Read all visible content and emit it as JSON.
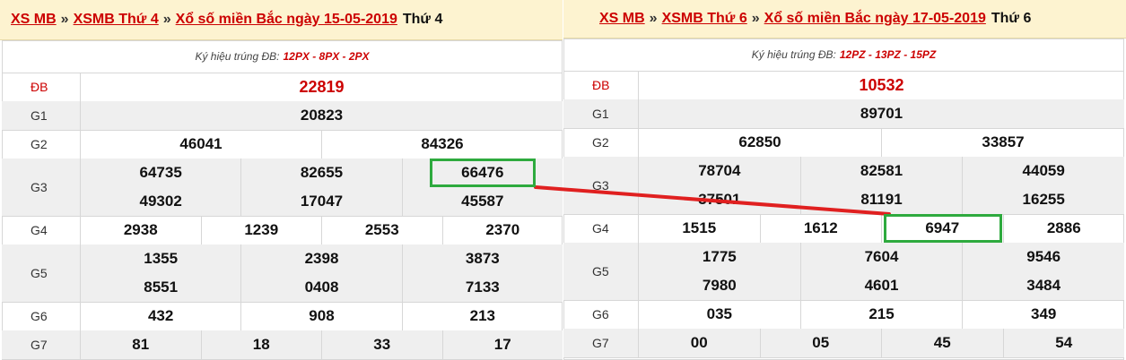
{
  "left": {
    "header": {
      "crumb1": "XS MB",
      "crumb2": "XSMB Thứ 4",
      "crumb3": "Xổ số miền Bắc ngày 15-05-2019",
      "sep": "»",
      "day": "Thứ 4"
    },
    "symbol_label": "Ký hiệu trúng ĐB:",
    "symbol_codes": "12PX - 8PX - 2PX",
    "prizes": [
      {
        "label": "ĐB",
        "rows": [
          [
            "22819"
          ]
        ]
      },
      {
        "label": "G1",
        "rows": [
          [
            "20823"
          ]
        ]
      },
      {
        "label": "G2",
        "rows": [
          [
            "46041",
            "84326"
          ]
        ]
      },
      {
        "label": "G3",
        "rows": [
          [
            "64735",
            "82655",
            "66476"
          ],
          [
            "49302",
            "17047",
            "45587"
          ]
        ]
      },
      {
        "label": "G4",
        "rows": [
          [
            "2938",
            "1239",
            "2553",
            "2370"
          ]
        ]
      },
      {
        "label": "G5",
        "rows": [
          [
            "1355",
            "2398",
            "3873"
          ],
          [
            "8551",
            "0408",
            "7133"
          ]
        ]
      },
      {
        "label": "G6",
        "rows": [
          [
            "432",
            "908",
            "213"
          ]
        ]
      },
      {
        "label": "G7",
        "rows": [
          [
            "81",
            "18",
            "33",
            "17"
          ]
        ]
      }
    ]
  },
  "right": {
    "header": {
      "crumb1": "XS MB",
      "crumb2": "XSMB Thứ 6",
      "crumb3": "Xổ số miền Bắc ngày 17-05-2019",
      "sep": "»",
      "day": "Thứ 6"
    },
    "symbol_label": "Ký hiệu trúng ĐB:",
    "symbol_codes": "12PZ - 13PZ - 15PZ",
    "prizes": [
      {
        "label": "ĐB",
        "rows": [
          [
            "10532"
          ]
        ]
      },
      {
        "label": "G1",
        "rows": [
          [
            "89701"
          ]
        ]
      },
      {
        "label": "G2",
        "rows": [
          [
            "62850",
            "33857"
          ]
        ]
      },
      {
        "label": "G3",
        "rows": [
          [
            "78704",
            "82581",
            "44059"
          ],
          [
            "37501",
            "81191",
            "16255"
          ]
        ]
      },
      {
        "label": "G4",
        "rows": [
          [
            "1515",
            "1612",
            "6947",
            "2886"
          ]
        ]
      },
      {
        "label": "G5",
        "rows": [
          [
            "1775",
            "7604",
            "9546"
          ],
          [
            "7980",
            "4601",
            "3484"
          ]
        ]
      },
      {
        "label": "G6",
        "rows": [
          [
            "035",
            "215",
            "349"
          ]
        ]
      },
      {
        "label": "G7",
        "rows": [
          [
            "00",
            "05",
            "45",
            "54"
          ]
        ]
      }
    ]
  },
  "annotation": {
    "highlight_color": "#2eaa3e",
    "connector_color": "#e02020",
    "from": "66476",
    "to": "6947"
  }
}
